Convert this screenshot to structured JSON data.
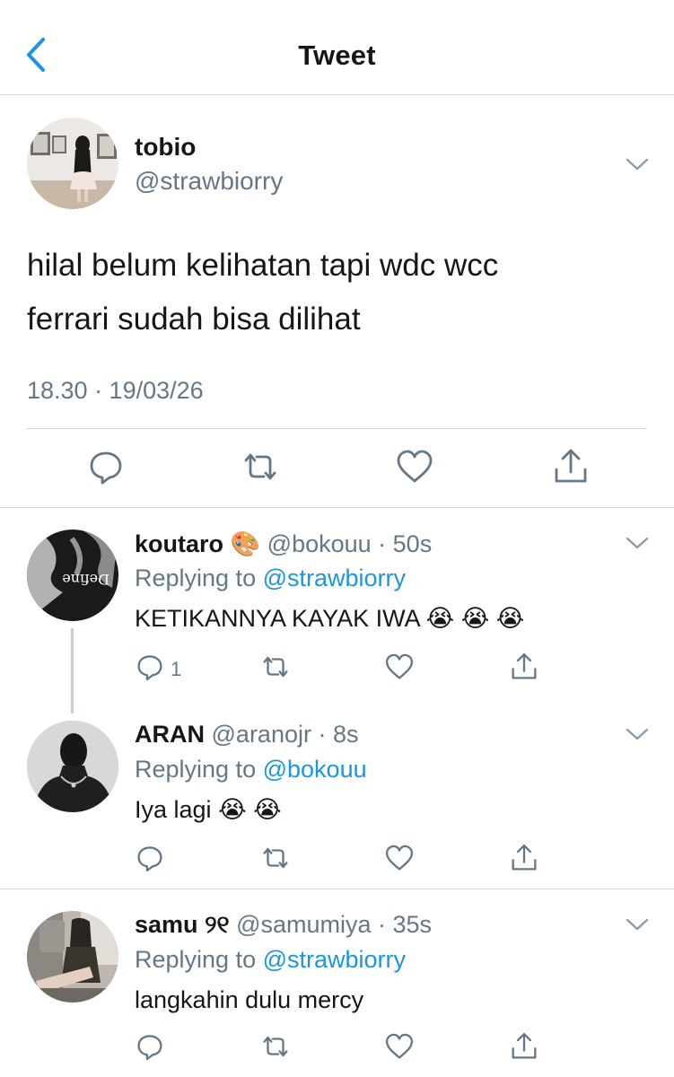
{
  "header": {
    "title": "Tweet",
    "back_icon": "chevron-left-icon"
  },
  "main_tweet": {
    "name": "tobio",
    "handle": "@strawbiorry",
    "text_line1": "hilal belum kelihatan tapi wdc wcc",
    "text_line2": "ferrari sudah bisa dilihat",
    "timestamp": "18.30 · 19/03/26",
    "actions": [
      "reply-icon",
      "retweet-icon",
      "like-icon",
      "share-icon"
    ]
  },
  "replies": [
    {
      "name": "koutaro",
      "badge_emoji": "🎨",
      "handle_time": "@bokouu · 50s",
      "replying_prefix": "Replying to",
      "replying_to": "@strawbiorry",
      "text": "KETIKANNYA KAYAK IWA",
      "emojis": [
        "😭",
        "😭",
        "😭"
      ],
      "reply_count": "1"
    },
    {
      "name": "ARAN",
      "handle_time": "@aranojr · 8s",
      "replying_prefix": "Replying to",
      "replying_to": "@bokouu",
      "text": "Iya lagi",
      "emojis": [
        "😭",
        "😭"
      ],
      "reply_count": ""
    },
    {
      "name": "samu",
      "name_suffix": "୨୧",
      "handle_time": "@samumiya · 35s",
      "replying_prefix": "Replying to",
      "replying_to": "@strawbiorry",
      "text": "langkahin dulu mercy",
      "reply_count": ""
    }
  ],
  "colors": {
    "accent": "#1b95e0",
    "secondary_text": "#657786",
    "icon": "#657786",
    "divider": "#d6d9dc"
  }
}
